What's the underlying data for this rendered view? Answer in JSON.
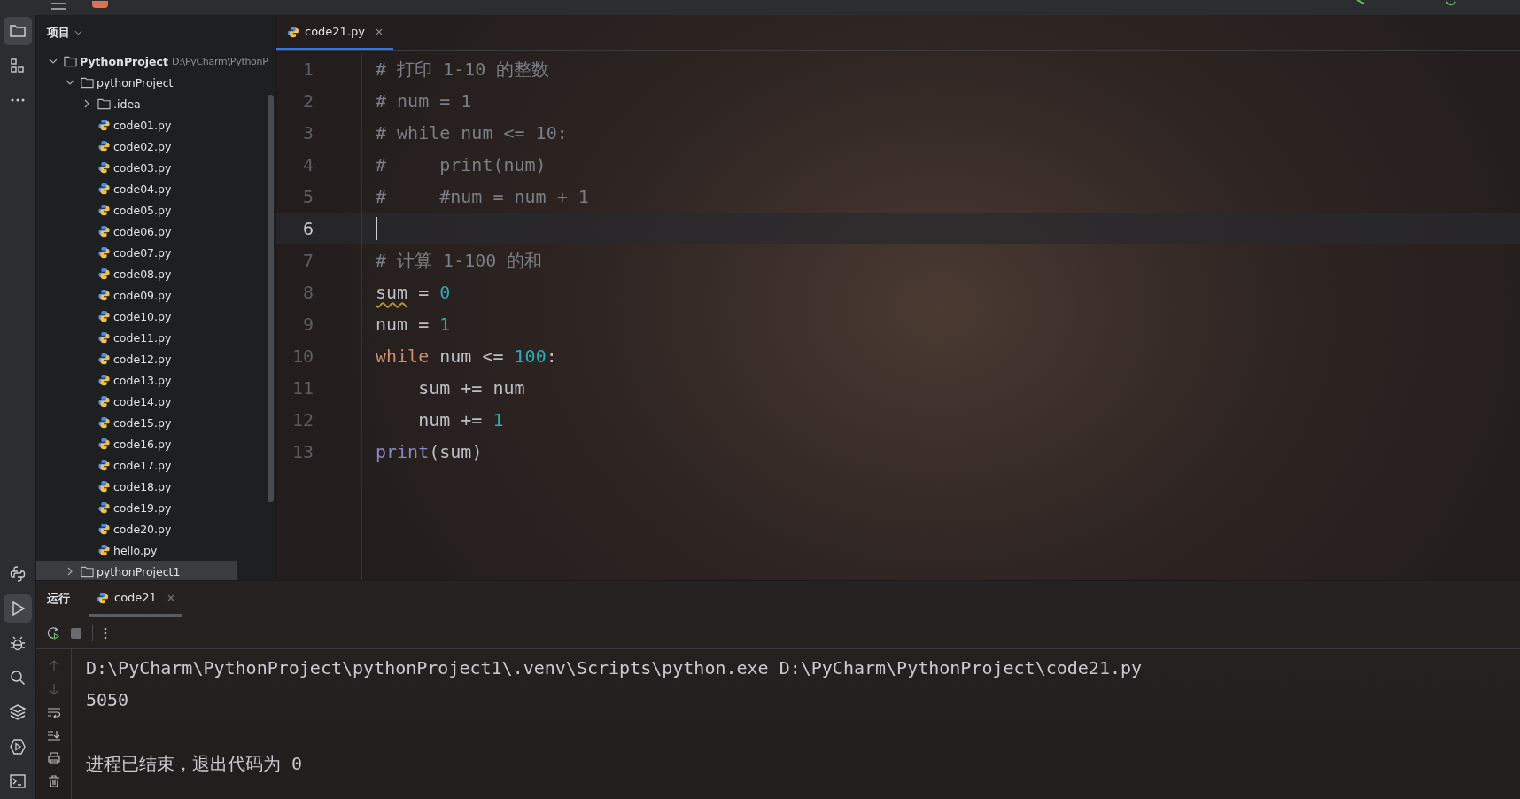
{
  "project_panel": {
    "title": "项目",
    "tree": [
      {
        "label": "PythonProject",
        "path": "D:\\PyCharm\\PythonP",
        "kind": "folder",
        "expanded": true,
        "children": [
          {
            "label": "pythonProject",
            "kind": "folder",
            "expanded": true,
            "children": [
              {
                "label": ".idea",
                "kind": "folder",
                "expanded": false
              },
              {
                "label": "code01.py",
                "kind": "python"
              },
              {
                "label": "code02.py",
                "kind": "python"
              },
              {
                "label": "code03.py",
                "kind": "python"
              },
              {
                "label": "code04.py",
                "kind": "python"
              },
              {
                "label": "code05.py",
                "kind": "python"
              },
              {
                "label": "code06.py",
                "kind": "python"
              },
              {
                "label": "code07.py",
                "kind": "python"
              },
              {
                "label": "code08.py",
                "kind": "python"
              },
              {
                "label": "code09.py",
                "kind": "python"
              },
              {
                "label": "code10.py",
                "kind": "python"
              },
              {
                "label": "code11.py",
                "kind": "python"
              },
              {
                "label": "code12.py",
                "kind": "python"
              },
              {
                "label": "code13.py",
                "kind": "python"
              },
              {
                "label": "code14.py",
                "kind": "python"
              },
              {
                "label": "code15.py",
                "kind": "python"
              },
              {
                "label": "code16.py",
                "kind": "python"
              },
              {
                "label": "code17.py",
                "kind": "python"
              },
              {
                "label": "code18.py",
                "kind": "python"
              },
              {
                "label": "code19.py",
                "kind": "python"
              },
              {
                "label": "code20.py",
                "kind": "python"
              },
              {
                "label": "hello.py",
                "kind": "python"
              }
            ]
          },
          {
            "label": "pythonProject1",
            "kind": "folder",
            "expanded": false
          }
        ]
      }
    ]
  },
  "editor": {
    "tabs": [
      {
        "label": "code21.py",
        "selected": true
      }
    ],
    "lines": [
      {
        "number": "1",
        "current": false,
        "tokens": [
          {
            "kind": "comment",
            "text": "# 打印 1-10 的整数"
          }
        ]
      },
      {
        "number": "2",
        "current": false,
        "tokens": [
          {
            "kind": "comment",
            "text": "# num = 1"
          }
        ]
      },
      {
        "number": "3",
        "current": false,
        "tokens": [
          {
            "kind": "comment",
            "text": "# while num <= 10:"
          }
        ]
      },
      {
        "number": "4",
        "current": false,
        "tokens": [
          {
            "kind": "comment",
            "text": "#     print(num)"
          }
        ]
      },
      {
        "number": "5",
        "current": false,
        "tokens": [
          {
            "kind": "comment",
            "text": "#     #num = num + 1"
          }
        ]
      },
      {
        "number": "6",
        "current": true
      },
      {
        "number": "7",
        "current": false,
        "tokens": [
          {
            "kind": "comment",
            "text": "# 计算 1-100 的和"
          }
        ]
      },
      {
        "number": "8",
        "current": false,
        "tokens": [
          {
            "kind": "plain",
            "text": "sum",
            "warning": true
          },
          {
            "kind": "plain",
            "text": " = "
          },
          {
            "kind": "number",
            "text": "0"
          }
        ]
      },
      {
        "number": "9",
        "current": false,
        "tokens": [
          {
            "kind": "plain",
            "text": "num = "
          },
          {
            "kind": "number",
            "text": "1"
          }
        ]
      },
      {
        "number": "10",
        "current": false,
        "tokens": [
          {
            "kind": "keyword",
            "text": "while"
          },
          {
            "kind": "plain",
            "text": " num <= "
          },
          {
            "kind": "number",
            "text": "100"
          },
          {
            "kind": "plain",
            "text": ":"
          }
        ]
      },
      {
        "number": "11",
        "current": false,
        "tokens": [
          {
            "kind": "plain",
            "text": "    sum += num"
          }
        ]
      },
      {
        "number": "12",
        "current": false,
        "tokens": [
          {
            "kind": "plain",
            "text": "    num += "
          },
          {
            "kind": "number",
            "text": "1"
          }
        ]
      },
      {
        "number": "13",
        "current": false,
        "tokens": [
          {
            "kind": "builtin",
            "text": "print"
          },
          {
            "kind": "plain",
            "text": "(sum)"
          }
        ]
      }
    ]
  },
  "run_panel": {
    "title": "运行",
    "tabs": [
      {
        "label": "code21",
        "selected": true
      }
    ],
    "output": [
      {
        "kind": "command",
        "text": "D:\\PyCharm\\PythonProject\\pythonProject1\\.venv\\Scripts\\python.exe D:\\PyCharm\\PythonProject\\code21.py"
      },
      {
        "kind": "output",
        "text": "5050"
      },
      {
        "kind": "exit",
        "text": "进程已结束，退出代码为 0"
      }
    ]
  }
}
